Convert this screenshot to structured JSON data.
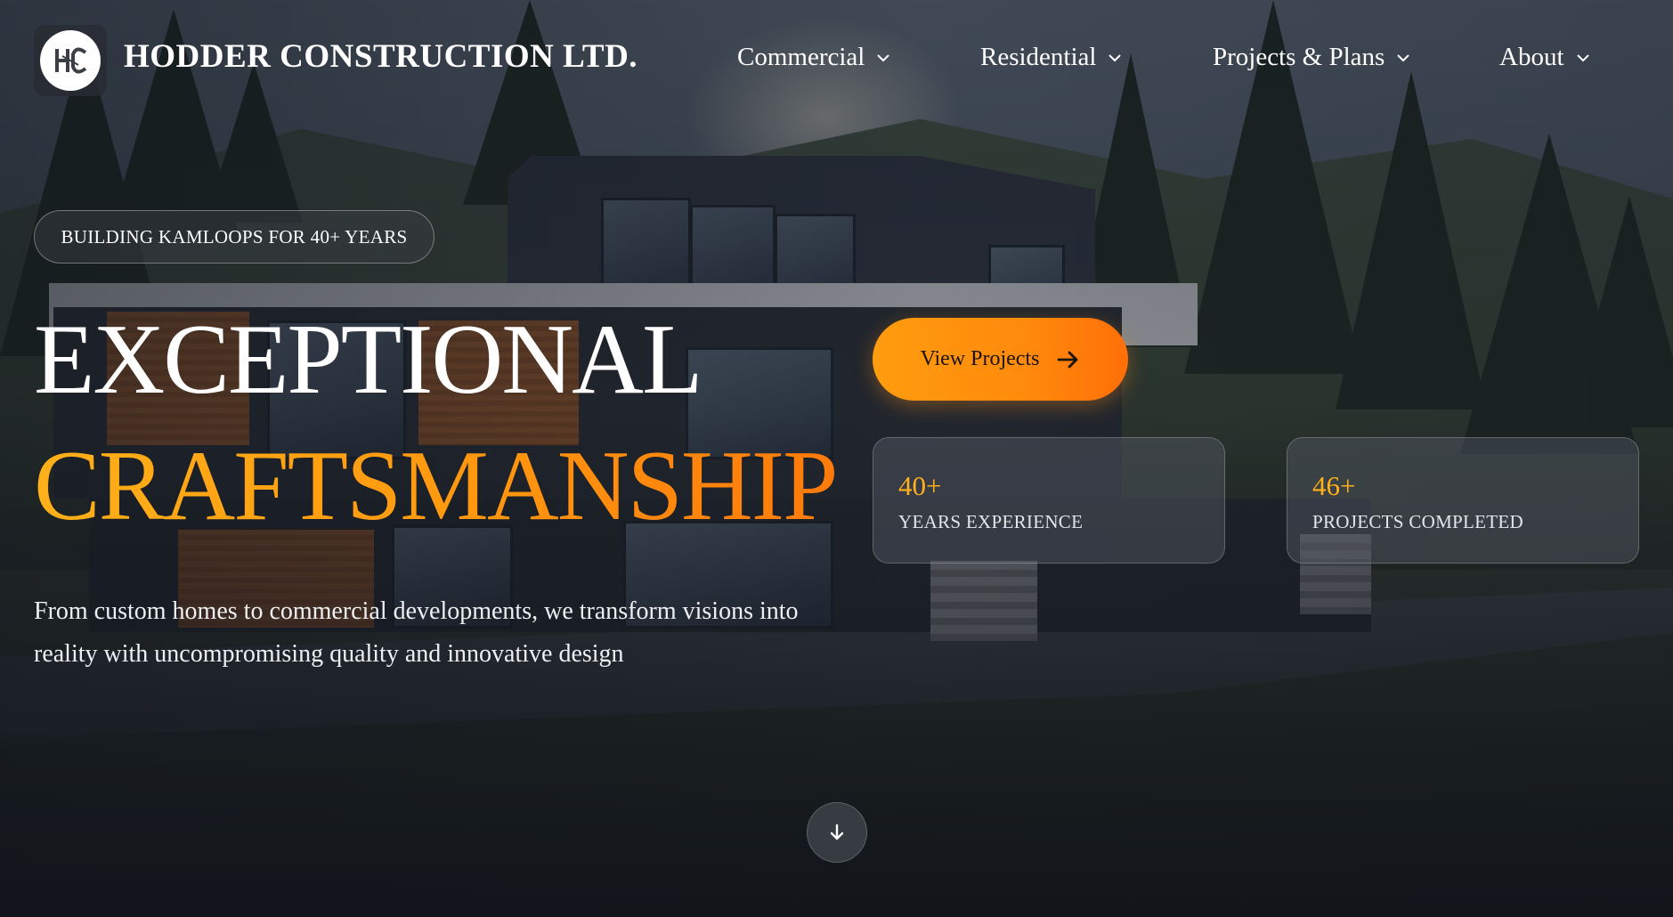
{
  "brand": {
    "name": "HODDER CONSTRUCTION LTD.",
    "logo_icon": "hc-monogram-logo"
  },
  "nav": {
    "items": [
      {
        "label": "Commercial",
        "icon": "chevron-down-icon"
      },
      {
        "label": "Residential",
        "icon": "chevron-down-icon"
      },
      {
        "label": "Projects & Plans",
        "icon": "chevron-down-icon"
      },
      {
        "label": "About",
        "icon": "chevron-down-icon"
      }
    ]
  },
  "hero": {
    "badge": "BUILDING KAMLOOPS FOR 40+ YEARS",
    "headline_1": "EXCEPTIONAL",
    "headline_2": "CRAFTSMANSHIP",
    "lead": "From custom homes to commercial developments, we transform visions into reality with uncompromising quality and innovative design",
    "cta_label": "View Projects",
    "cta_icon": "arrow-right-icon",
    "scroll_icon": "arrow-down-icon"
  },
  "stats": [
    {
      "value": "40+",
      "label": "YEARS EXPERIENCE"
    },
    {
      "value": "46+",
      "label": "PROJECTS COMPLETED"
    }
  ],
  "colors": {
    "accent": "#ff9a10",
    "accent_end": "#ff6f08",
    "stat_value": "#ffb01a"
  }
}
